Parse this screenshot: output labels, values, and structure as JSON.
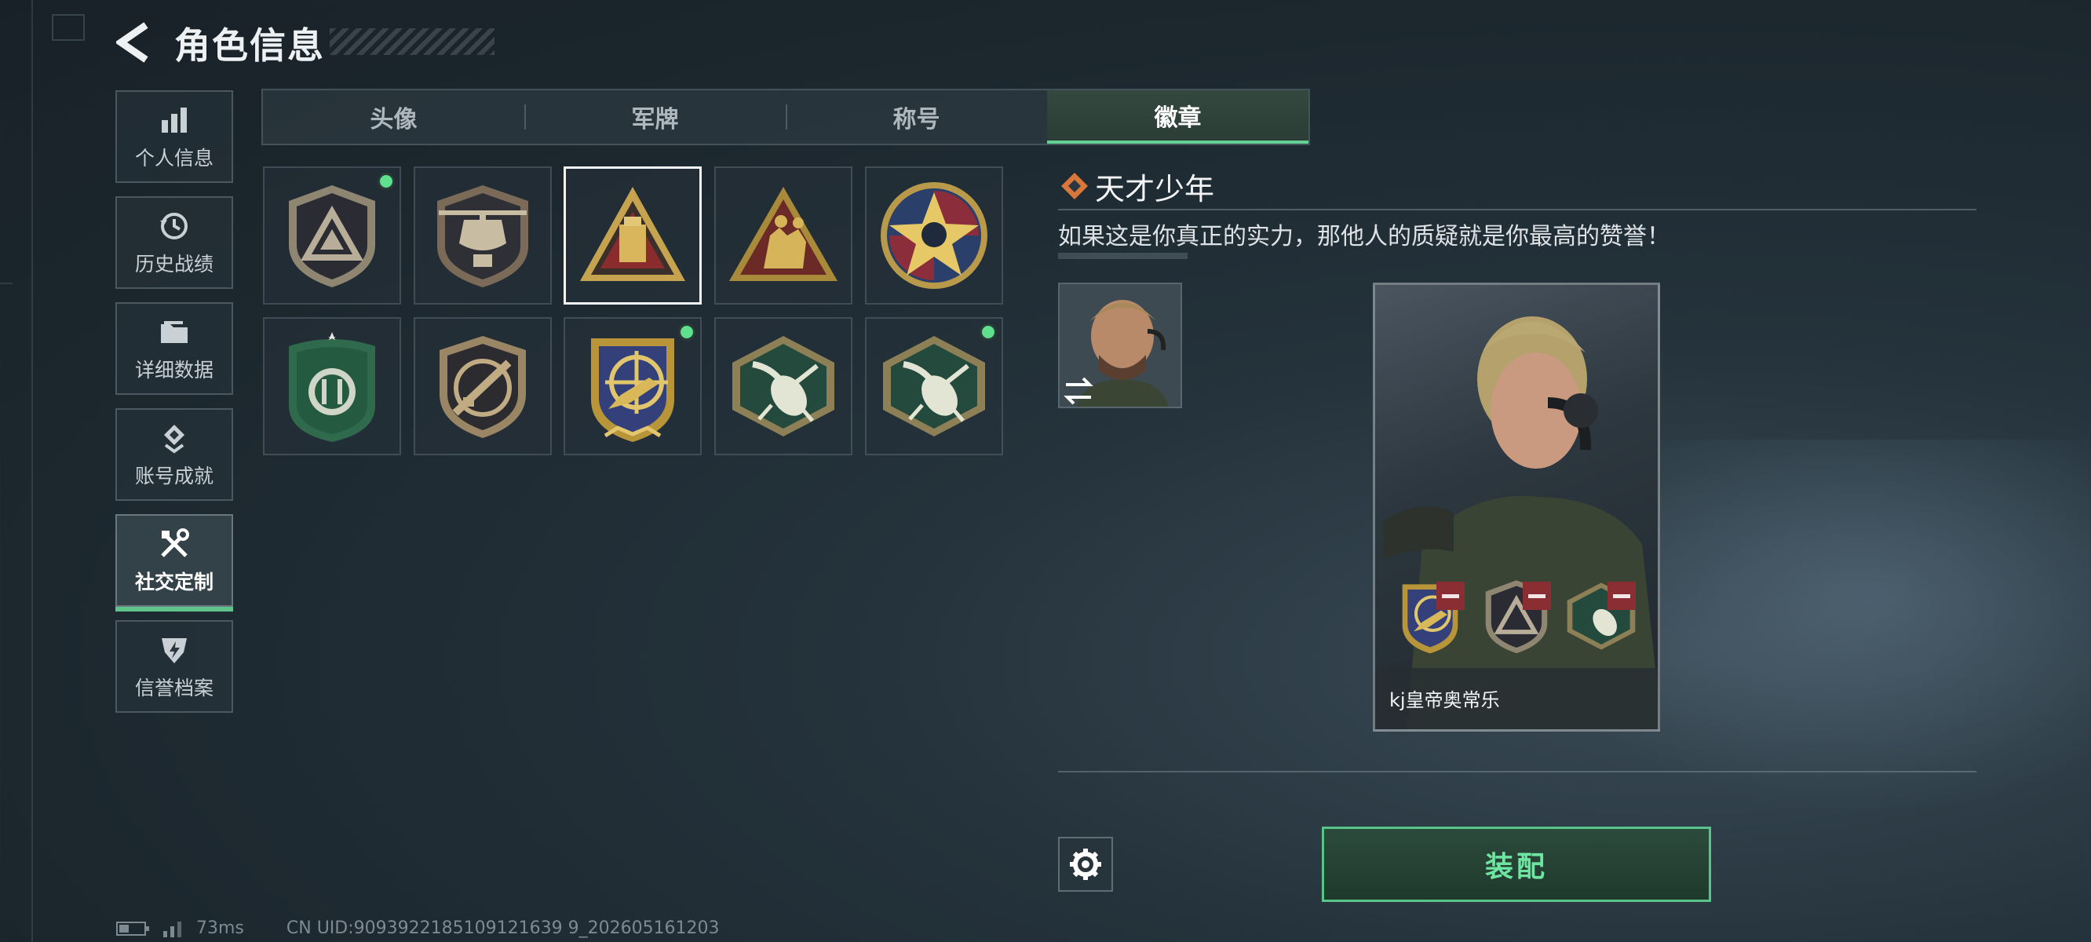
{
  "header": {
    "title": "角色信息"
  },
  "sidebar": {
    "items": [
      {
        "label": "个人信息",
        "icon": "bar-chart-icon"
      },
      {
        "label": "历史战绩",
        "icon": "history-icon"
      },
      {
        "label": "详细数据",
        "icon": "folder-icon"
      },
      {
        "label": "账号成就",
        "icon": "achievement-icon"
      },
      {
        "label": "社交定制",
        "icon": "tools-icon",
        "active": true
      },
      {
        "label": "信誉档案",
        "icon": "shield-bolt-icon"
      }
    ]
  },
  "tabs": [
    {
      "label": "头像"
    },
    {
      "label": "军牌"
    },
    {
      "label": "称号"
    },
    {
      "label": "徽章",
      "active": true
    }
  ],
  "badges": [
    {
      "icon": "triangle-shield-badge-icon",
      "equipped": true
    },
    {
      "icon": "helicopter-badge-icon",
      "equipped": false
    },
    {
      "icon": "usb-triangle-badge-icon",
      "equipped": false,
      "selected": true
    },
    {
      "icon": "soldiers-triangle-badge-icon",
      "equipped": false
    },
    {
      "icon": "star-skull-badge-icon",
      "equipped": false
    },
    {
      "icon": "green-shield-badge-icon",
      "equipped": false
    },
    {
      "icon": "rifle-shield-badge-icon",
      "equipped": false
    },
    {
      "icon": "crosshair-eagle-badge-icon",
      "equipped": true
    },
    {
      "icon": "wasp-hexagon-badge-icon",
      "equipped": false
    },
    {
      "icon": "wasp-hexagon-badge-icon",
      "equipped": true
    }
  ],
  "detail": {
    "name": "天才少年",
    "description": "如果这是你真正的实力，那他人的质疑就是你最高的赞誉！",
    "player_name": "kj皇帝奥常乐"
  },
  "actions": {
    "equip_label": "装配"
  },
  "footer": {
    "ping": "73ms",
    "uid": "CN UID:9093922185109121639 9_202605161203"
  },
  "colors": {
    "accent": "#5fc48b",
    "equipped_dot": "#5ee08f",
    "remove": "#8a2e33"
  }
}
